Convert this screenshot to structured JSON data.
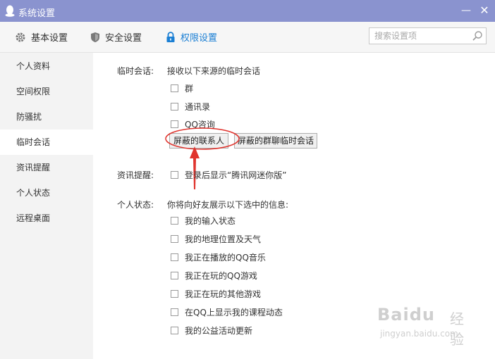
{
  "window": {
    "title": "系统设置",
    "minimize": "—",
    "close": "✕"
  },
  "toolbar": {
    "tabs": [
      {
        "label": "基本设置",
        "icon": "gear-icon"
      },
      {
        "label": "安全设置",
        "icon": "shield-icon"
      },
      {
        "label": "权限设置",
        "icon": "lock-icon"
      }
    ],
    "active_tab": "权限设置",
    "search_placeholder": "搜索设置项"
  },
  "sidebar": {
    "items": [
      "个人资料",
      "空间权限",
      "防骚扰",
      "临时会话",
      "资讯提醒",
      "个人状态",
      "远程桌面"
    ],
    "active_index": 3
  },
  "temp_session": {
    "label": "临时会话:",
    "description": "接收以下来源的临时会话",
    "options": [
      {
        "label": "群",
        "checked": false
      },
      {
        "label": "通讯录",
        "checked": false
      },
      {
        "label": "QQ咨询",
        "checked": false
      }
    ],
    "buttons": [
      "屏蔽的联系人",
      "屏蔽的群聊临时会话"
    ]
  },
  "news_alert": {
    "label": "资讯提醒:",
    "option": {
      "label": "登录后显示“腾讯网迷你版”",
      "checked": false
    }
  },
  "personal_status": {
    "label": "个人状态:",
    "description": "你将向好友展示以下选中的信息:",
    "options": [
      {
        "label": "我的输入状态",
        "checked": false
      },
      {
        "label": "我的地理位置及天气",
        "checked": false
      },
      {
        "label": "我正在播放的QQ音乐",
        "checked": false
      },
      {
        "label": "我正在玩的QQ游戏",
        "checked": false
      },
      {
        "label": "我正在玩的其他游戏",
        "checked": false
      },
      {
        "label": "在QQ上显示我的课程动态",
        "checked": false
      },
      {
        "label": "我的公益活动更新",
        "checked": false
      }
    ]
  },
  "colors": {
    "titlebar": "#8a93cf",
    "accent": "#1b7fd4",
    "annotation": "#e0342e"
  },
  "watermark": {
    "brand": "Baidu",
    "suffix": "经验",
    "url": "jingyan.baidu.com"
  }
}
